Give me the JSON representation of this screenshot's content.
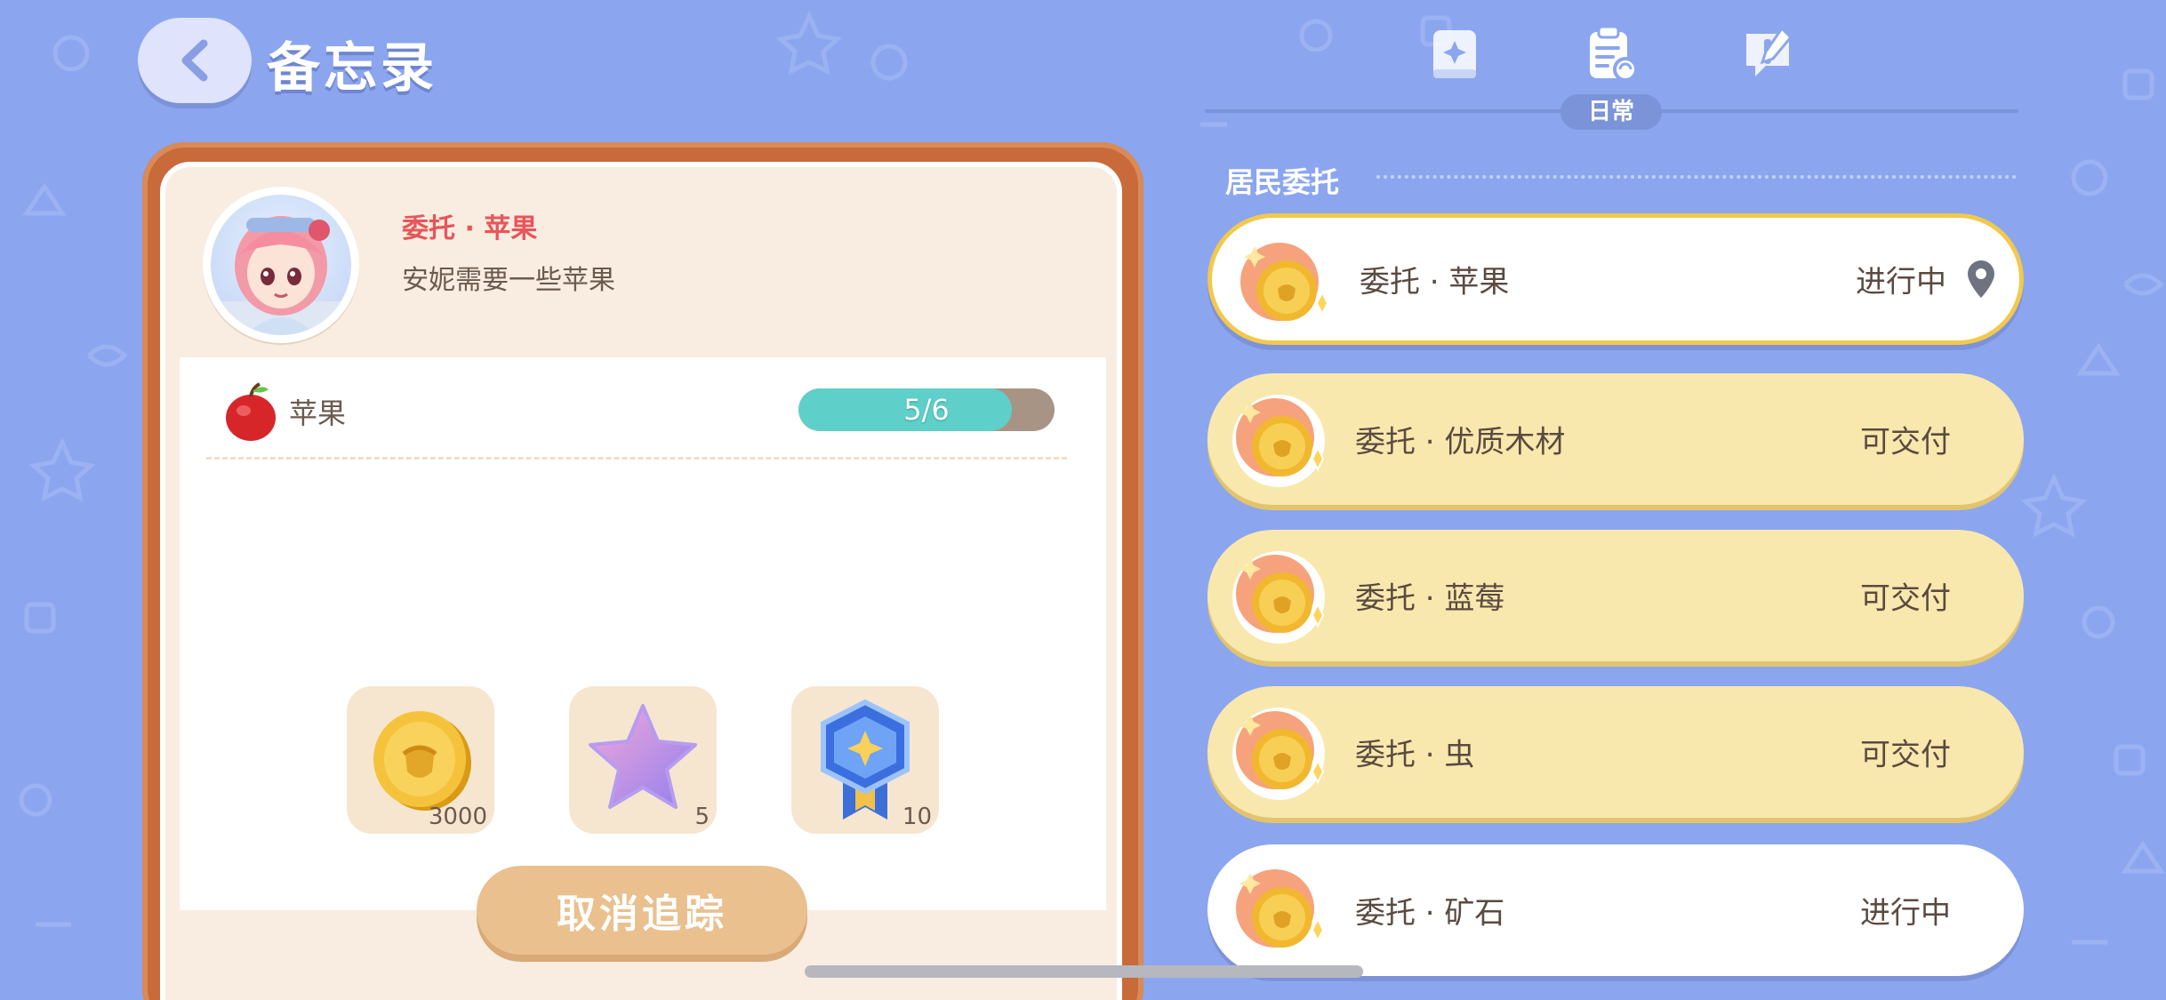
{
  "header": {
    "title": "备忘录"
  },
  "tabs": [
    {
      "icon": "book-icon",
      "label": ""
    },
    {
      "icon": "daily-clipboard-icon",
      "label": "日常",
      "active": true
    },
    {
      "icon": "notice-icon",
      "label": ""
    }
  ],
  "detail": {
    "quest_name": "委托 · 苹果",
    "quest_desc": "安妮需要一些苹果",
    "requirement": {
      "item": "苹果",
      "progress_text": "5/6",
      "progress_fraction": 0.833
    },
    "rewards": [
      {
        "icon": "gold-coin-icon",
        "count": "3000"
      },
      {
        "icon": "purple-star-icon",
        "count": "5"
      },
      {
        "icon": "badge-medal-icon",
        "count": "10"
      }
    ],
    "cancel_label": "取消追踪"
  },
  "list": {
    "section_title": "居民委托",
    "items": [
      {
        "name": "委托 · 苹果",
        "status": "进行中",
        "style": "selected"
      },
      {
        "name": "委托 · 优质木材",
        "status": "可交付",
        "style": "yellow"
      },
      {
        "name": "委托 · 蓝莓",
        "status": "可交付",
        "style": "yellow"
      },
      {
        "name": "委托 · 虫",
        "status": "可交付",
        "style": "yellow"
      },
      {
        "name": "委托 · 矿石",
        "status": "进行中",
        "style": "white"
      }
    ]
  },
  "colors": {
    "background": "#8ba6ef",
    "accent_red": "#e8555a",
    "frame_brown": "#c86a3a",
    "deliverable_yellow": "#f9e8ad",
    "progress_teal": "#5fd0c9"
  }
}
